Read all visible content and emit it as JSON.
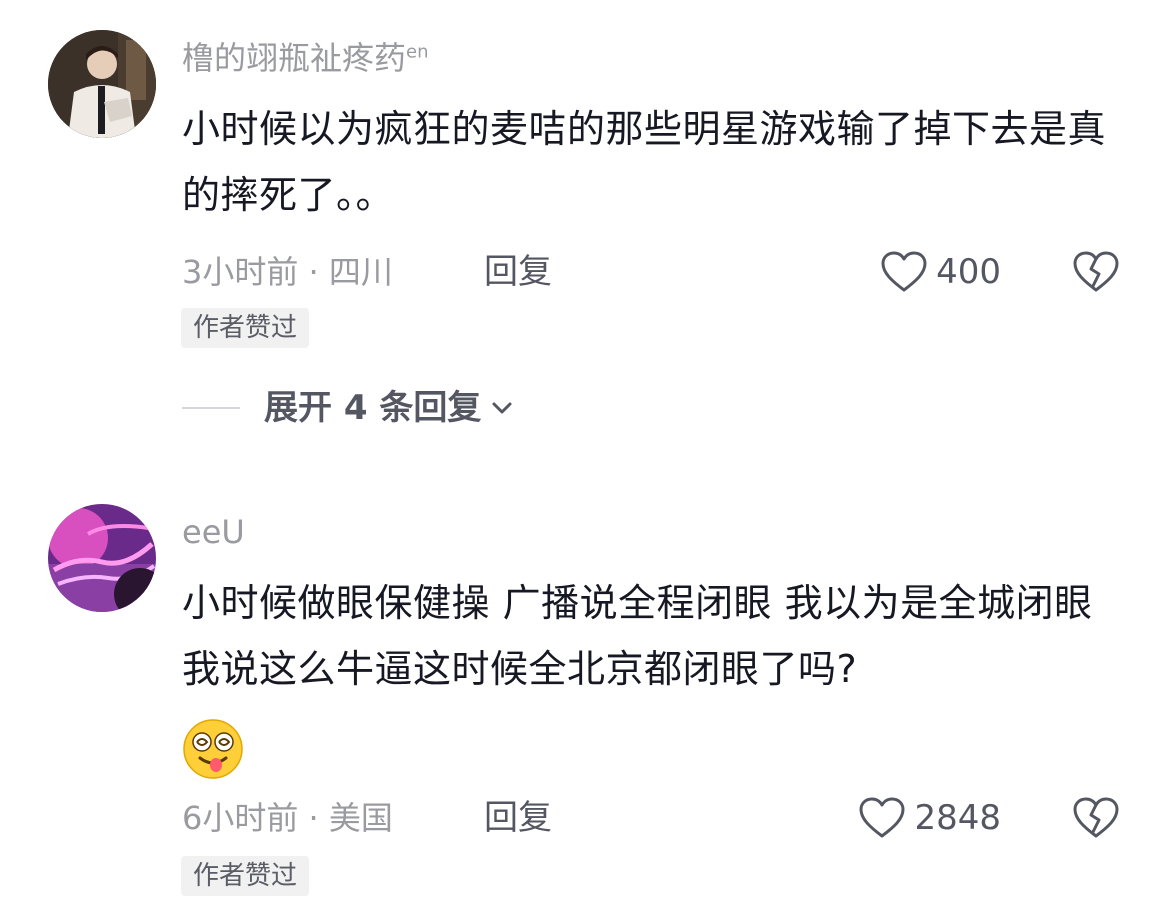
{
  "comments": [
    {
      "username": "橹的翊瓶祉疼药",
      "username_suffix": "en",
      "text": "小时候以为疯狂的麦咭的那些明星游戏输了掉下去是真的摔死了。。",
      "time_location": "3小时前 · 四川",
      "reply_label": "回复",
      "likes": "400",
      "badge": "作者赞过",
      "expand_label": "展开 4 条回复",
      "avatar_icon": "avatar-person-photo"
    },
    {
      "username": "eeU",
      "text": "小时候做眼保健操 广播说全程闭眼 我以为是全城闭眼 我说这么牛逼这时候全北京都闭眼了吗?",
      "emoji_icon": "dizzy-tongue-emoji",
      "time_location": "6小时前 · 美国",
      "reply_label": "回复",
      "likes": "2848",
      "badge": "作者赞过",
      "avatar_icon": "avatar-neon-purple"
    }
  ],
  "colors": {
    "primary_text": "#161823",
    "secondary_text": "#9a9ba0",
    "action_text": "#545762",
    "badge_bg": "#f1f1f2"
  }
}
